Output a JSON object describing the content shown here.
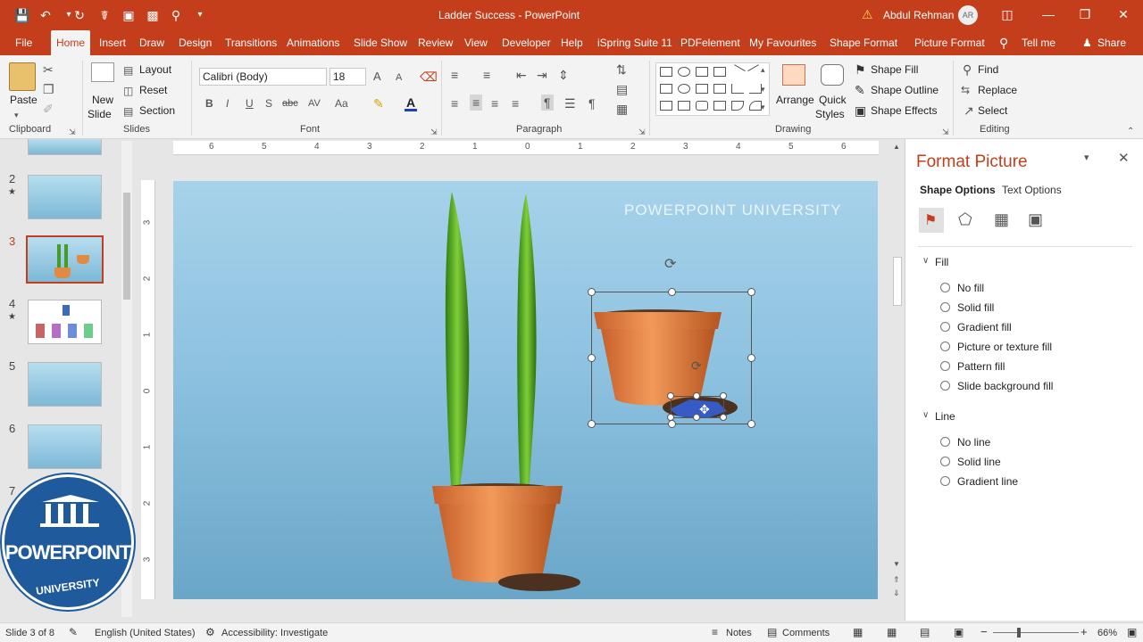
{
  "app": {
    "title": "Ladder Success - PowerPoint",
    "user": "Abdul Rehman",
    "user_initials": "AR",
    "accent": "#c43e1c"
  },
  "qat_icons": [
    "save-icon",
    "undo-icon",
    "redo-icon",
    "touch-mode-icon",
    "present-icon",
    "clipboard-icon",
    "preview-icon",
    "customize-icon"
  ],
  "tabs": [
    "File",
    "Home",
    "Insert",
    "Draw",
    "Design",
    "Transitions",
    "Animations",
    "Slide Show",
    "Review",
    "View",
    "Developer",
    "Help",
    "iSpring Suite 11",
    "PDFelement",
    "My Favourites",
    "Shape Format",
    "Picture Format"
  ],
  "active_tab": "Home",
  "tell_me": "Tell me",
  "share": "Share",
  "ribbon": {
    "clipboard": {
      "label": "Clipboard",
      "paste": "Paste"
    },
    "slides": {
      "label": "Slides",
      "new_slide_1": "New",
      "new_slide_2": "Slide",
      "layout": "Layout",
      "reset": "Reset",
      "section": "Section"
    },
    "font": {
      "label": "Font",
      "font_name": "Calibri (Body)",
      "font_size": "18",
      "bold": "B",
      "italic": "I",
      "underline": "U",
      "shadow": "S",
      "strike": "abc",
      "spacing": "AV",
      "case": "Aa"
    },
    "paragraph": {
      "label": "Paragraph"
    },
    "drawing": {
      "label": "Drawing",
      "arrange": "Arrange",
      "quick_styles_1": "Quick",
      "quick_styles_2": "Styles",
      "shape_fill": "Shape Fill",
      "shape_outline": "Shape Outline",
      "shape_effects": "Shape Effects"
    },
    "editing": {
      "label": "Editing",
      "find": "Find",
      "replace": "Replace",
      "select": "Select"
    }
  },
  "thumbnails": [
    {
      "num": "2",
      "star": "★"
    },
    {
      "num": "3",
      "star": ""
    },
    {
      "num": "4",
      "star": "★"
    },
    {
      "num": "5",
      "star": ""
    },
    {
      "num": "6",
      "star": ""
    },
    {
      "num": "7",
      "star": ""
    }
  ],
  "ruler": {
    "h_ticks": [
      "6",
      "5",
      "4",
      "3",
      "2",
      "1",
      "0",
      "1",
      "2",
      "3",
      "4",
      "5",
      "6"
    ],
    "v_ticks": [
      "3",
      "2",
      "1",
      "0",
      "1",
      "2",
      "3"
    ]
  },
  "slide": {
    "watermark": "POWERPOINT UNIVERSITY"
  },
  "logo": {
    "line1": "POWERPOINT",
    "line2": "UNIVERSITY"
  },
  "panel": {
    "title": "Format Picture",
    "tab_shape": "Shape Options",
    "tab_text": "Text Options",
    "icons": [
      "fill-line-icon",
      "effects-icon",
      "size-properties-icon",
      "picture-icon"
    ],
    "fill_section": "Fill",
    "fill_options": [
      "No fill",
      "Solid fill",
      "Gradient fill",
      "Picture or texture fill",
      "Pattern fill",
      "Slide background fill"
    ],
    "line_section": "Line",
    "line_options": [
      "No line",
      "Solid line",
      "Gradient line"
    ]
  },
  "status": {
    "slide_info": "Slide 3 of 8",
    "language": "English (United States)",
    "accessibility": "Accessibility: Investigate",
    "notes": "Notes",
    "comments": "Comments",
    "zoom": "66%"
  }
}
